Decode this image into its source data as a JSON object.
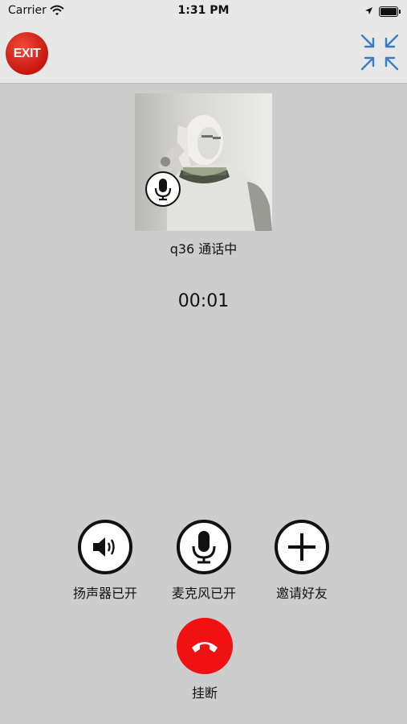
{
  "status_bar": {
    "carrier": "Carrier",
    "time": "1:31 PM"
  },
  "nav": {
    "exit_label": "EXIT"
  },
  "call": {
    "caller_status": "q36 通话中",
    "timer": "00:01"
  },
  "controls": {
    "speaker_label": "扬声器已开",
    "mic_label": "麦克风已开",
    "invite_label": "邀请好友",
    "hangup_label": "挂断"
  },
  "colors": {
    "hangup": "#f01212",
    "exit": "#d21b13",
    "minimize_arrows": "#3a7fc1"
  },
  "icons": [
    "wifi-icon",
    "location-icon",
    "battery-icon",
    "exit-icon",
    "minimize-icon",
    "mic-icon",
    "speaker-icon",
    "plus-icon",
    "phone-hangup-icon"
  ]
}
